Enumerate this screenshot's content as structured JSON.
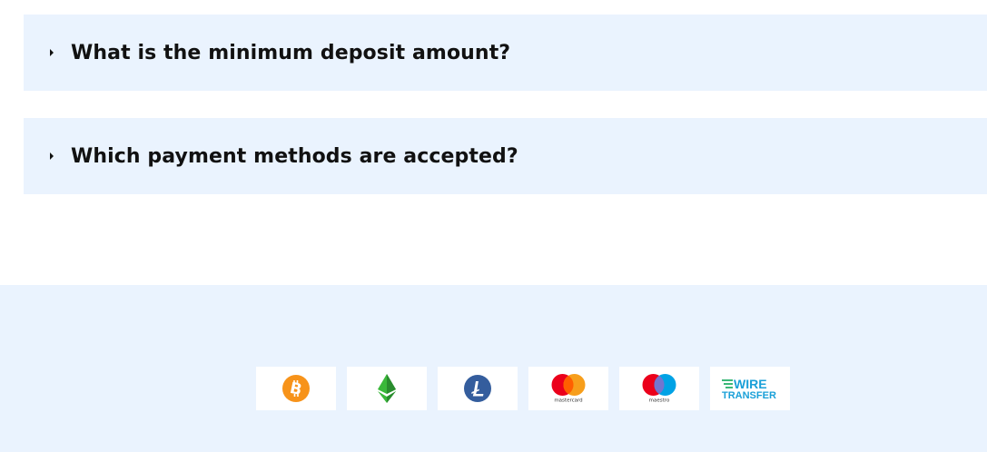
{
  "faq": {
    "items": [
      {
        "question": "What is the minimum deposit amount?"
      },
      {
        "question": "Which payment methods are accepted?"
      }
    ]
  },
  "payments": {
    "methods": [
      {
        "icon": "bitcoin-icon",
        "color": "#f7931a"
      },
      {
        "icon": "ethereum-icon",
        "color": "#3ab83a"
      },
      {
        "icon": "litecoin-icon",
        "color": "#345d9d"
      },
      {
        "icon": "mastercard-icon",
        "label": "mastercard",
        "colors": [
          "#eb001b",
          "#f79e1b"
        ]
      },
      {
        "icon": "maestro-icon",
        "label": "maestro",
        "colors": [
          "#eb001b",
          "#00a2e5"
        ]
      },
      {
        "icon": "wire-transfer-icon",
        "line1": "WIRE",
        "line2": "TRANSFER",
        "color": "#1aa0d8",
        "accent": "#3cb878"
      }
    ]
  }
}
